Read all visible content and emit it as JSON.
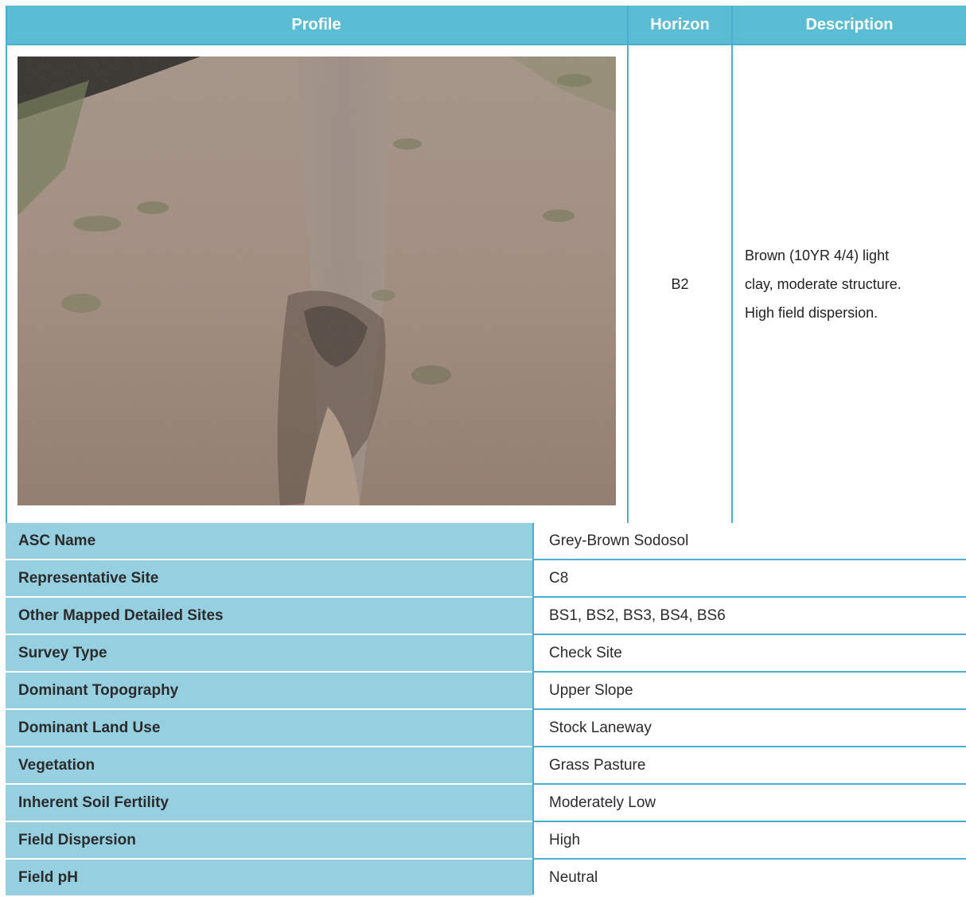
{
  "header": {
    "profile": "Profile",
    "horizon": "Horizon",
    "description": "Description"
  },
  "horizon": "B2",
  "description": {
    "line1": "Brown (10YR 4/4) light",
    "line2": "clay, moderate structure.",
    "line3": "High field dispersion."
  },
  "properties": [
    {
      "label": "ASC Name",
      "value": "Grey-Brown Sodosol"
    },
    {
      "label": "Representative Site",
      "value": "C8"
    },
    {
      "label": "Other Mapped Detailed Sites",
      "value": "BS1, BS2, BS3, BS4, BS6"
    },
    {
      "label": "Survey Type",
      "value": "Check Site"
    },
    {
      "label": "Dominant Topography",
      "value": "Upper Slope"
    },
    {
      "label": "Dominant Land Use",
      "value": "Stock Laneway"
    },
    {
      "label": "Vegetation",
      "value": "Grass Pasture"
    },
    {
      "label": "Inherent Soil Fertility",
      "value": "Moderately Low"
    },
    {
      "label": "Field Dispersion",
      "value": "High"
    },
    {
      "label": "Field pH",
      "value": "Neutral"
    }
  ],
  "colors": {
    "header_bg": "#5bbdd3",
    "label_bg": "#95cfe0",
    "border": "#4aaed0"
  }
}
